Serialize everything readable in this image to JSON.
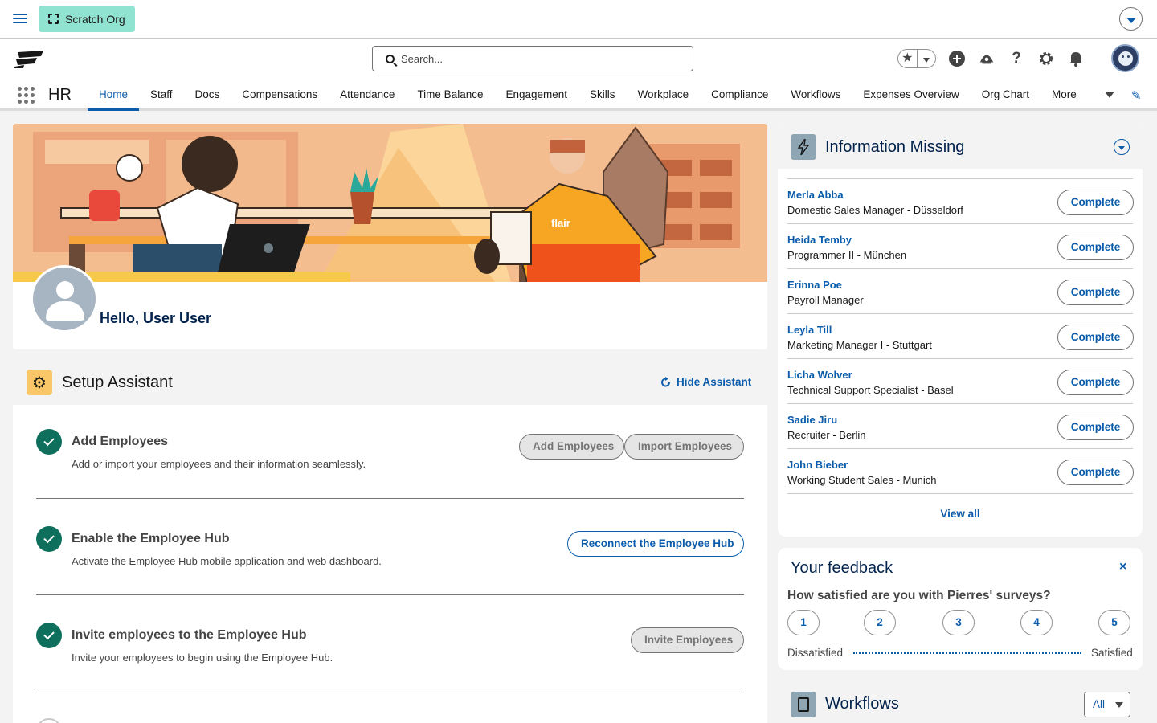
{
  "org": {
    "label": "Scratch Org"
  },
  "search": {
    "placeholder": "Search..."
  },
  "icons": {
    "menu": "hamburger-icon",
    "org": "dashed-square-icon",
    "profile_dropdown": "chevron-down-icon",
    "favorites": "star-icon",
    "add": "plus-circle-icon",
    "trailhead": "trailhead-icon",
    "help": "help-icon",
    "settings": "gear-icon",
    "notifications": "bell-icon",
    "edit_nav": "pencil-icon"
  },
  "colors": {
    "brand": "#0b5cab",
    "success": "#0f6f5d",
    "scratch_badge": "#91e3d1",
    "setup_icon_bg": "#f9c668"
  },
  "nav": {
    "app_name": "HR",
    "tabs": [
      "Home",
      "Staff",
      "Docs",
      "Compensations",
      "Attendance",
      "Time Balance",
      "Engagement",
      "Skills",
      "Workplace",
      "Compliance",
      "Workflows",
      "Expenses Overview",
      "Org Chart",
      "More"
    ],
    "active_tab": "Home"
  },
  "banner": {
    "logo_text": "flair"
  },
  "profile": {
    "greeting": "Hello, User User"
  },
  "setup": {
    "title": "Setup Assistant",
    "hide_label": "Hide Assistant",
    "steps": [
      {
        "title": "Add Employees",
        "description": "Add or import your employees and their information seamlessly.",
        "buttons": [
          "Add Employees",
          "Import Employees"
        ]
      },
      {
        "title": "Enable the Employee Hub",
        "description": "Activate the Employee Hub mobile application and web dashboard.",
        "buttons": [
          "Reconnect the Employee Hub"
        ]
      },
      {
        "title": "Invite employees to the Employee Hub",
        "description": "Invite your employees to begin using the Employee Hub.",
        "buttons": [
          "Invite Employees"
        ]
      }
    ]
  },
  "info_missing": {
    "title": "Information Missing",
    "action_label": "Complete",
    "view_all": "View all",
    "rows": [
      {
        "name": "Merla Abba",
        "role": "Domestic Sales Manager - Düsseldorf"
      },
      {
        "name": "Heida Temby",
        "role": "Programmer II - München"
      },
      {
        "name": "Erinna Poe",
        "role": "Payroll Manager"
      },
      {
        "name": "Leyla Till",
        "role": "Marketing Manager I - Stuttgart"
      },
      {
        "name": "Licha Wolver",
        "role": "Technical Support Specialist - Basel"
      },
      {
        "name": "Sadie Jiru",
        "role": "Recruiter - Berlin"
      },
      {
        "name": "John Bieber",
        "role": "Working Student Sales - Munich"
      }
    ]
  },
  "feedback": {
    "title": "Your feedback",
    "close": "×",
    "question": "How satisfied are you with Pierres' surveys?",
    "options": [
      "1",
      "2",
      "3",
      "4",
      "5"
    ],
    "low_label": "Dissatisfied",
    "high_label": "Satisfied"
  },
  "workflows": {
    "title": "Workflows",
    "filter": "All"
  }
}
